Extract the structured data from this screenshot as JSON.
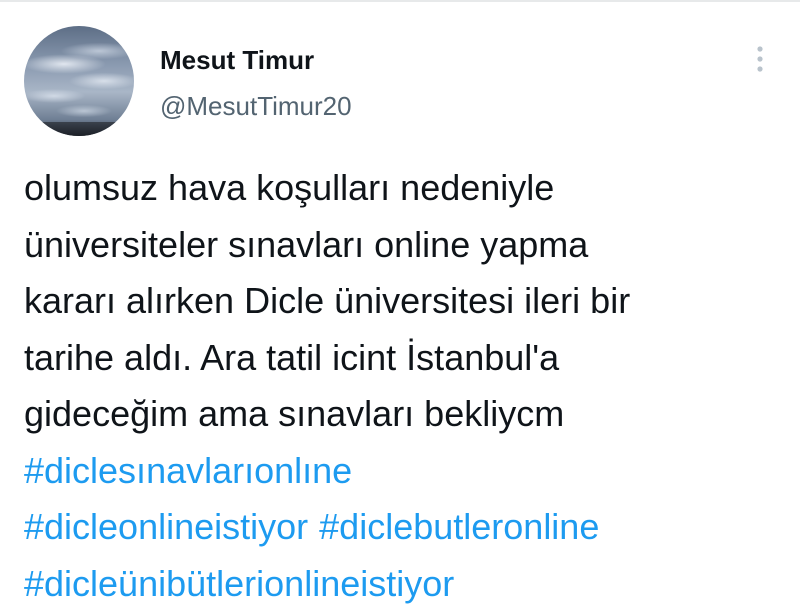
{
  "tweet": {
    "author": {
      "display_name": "Mesut Timur",
      "handle": "@MesutTimur20",
      "avatar_description": "sky-with-clouds-avatar"
    },
    "more_icon": "vertical-dots-icon",
    "text_lines": [
      "olumsuz hava koşulları nedeniyle",
      "üniversiteler sınavları online yapma",
      "kararı alırken Dicle üniversitesi ileri bir",
      "tarihe aldı. Ara tatil icint İstanbul'a",
      "gideceğim ama sınavları bekliycm"
    ],
    "hashtags": [
      "#diclesınavlarıonlıne",
      "#dicleonlineistiyor",
      "#diclebutleronline",
      "#dicleünibütlerionlineistiyor"
    ],
    "colors": {
      "text": "#0f1419",
      "secondary": "#536471",
      "link": "#1d9bf0",
      "icon": "#b9c3cc"
    }
  }
}
